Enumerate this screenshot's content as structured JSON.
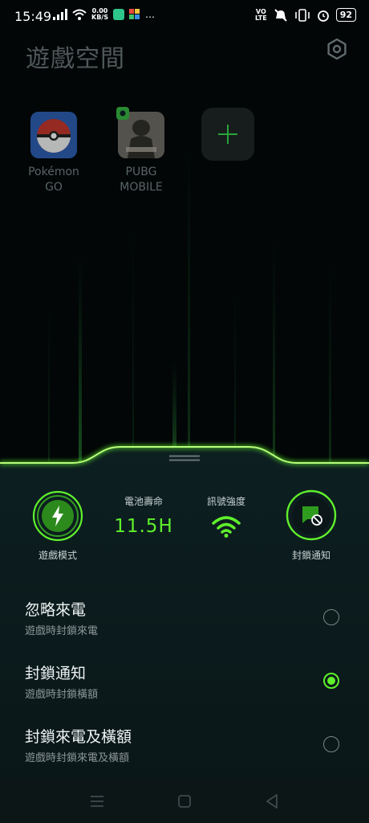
{
  "status_bar": {
    "time": "15:49",
    "speed_value": "0.00",
    "speed_unit": "KB/S",
    "more": "…",
    "volte_top": "VO",
    "volte_bottom": "LTE",
    "battery": "92",
    "icons": [
      "signal-icon",
      "wifi-icon",
      "app-notification-icon",
      "app-notification-icon-2",
      "mute-icon",
      "vibrate-icon",
      "alarm-icon",
      "battery-icon"
    ]
  },
  "header": {
    "title": "遊戲空間",
    "settings_icon": "settings-hexagon-icon"
  },
  "apps": [
    {
      "name": "Pokémon GO",
      "line1": "Pokémon",
      "line2": "GO"
    },
    {
      "name": "PUBG MOBILE",
      "line1": "PUBG",
      "line2": "MOBILE"
    },
    {
      "name": "add",
      "icon": "plus-icon"
    }
  ],
  "panel": {
    "game_mode_label": "遊戲模式",
    "battery_label": "電池壽命",
    "battery_value": "11.5H",
    "signal_label": "訊號強度",
    "block_label": "封鎖通知"
  },
  "options": [
    {
      "title": "忽略來電",
      "subtitle": "遊戲時封鎖來電",
      "selected": false
    },
    {
      "title": "封鎖通知",
      "subtitle": "遊戲時封鎖橫額",
      "selected": true
    },
    {
      "title": "封鎖來電及橫額",
      "subtitle": "遊戲時封鎖來電及橫額",
      "selected": false
    }
  ],
  "navbar": {
    "icons": [
      "menu-icon",
      "home-icon",
      "back-icon"
    ]
  },
  "colors": {
    "accent": "#5ff02c",
    "panel": "#0b1a1c",
    "background": "#020607"
  }
}
